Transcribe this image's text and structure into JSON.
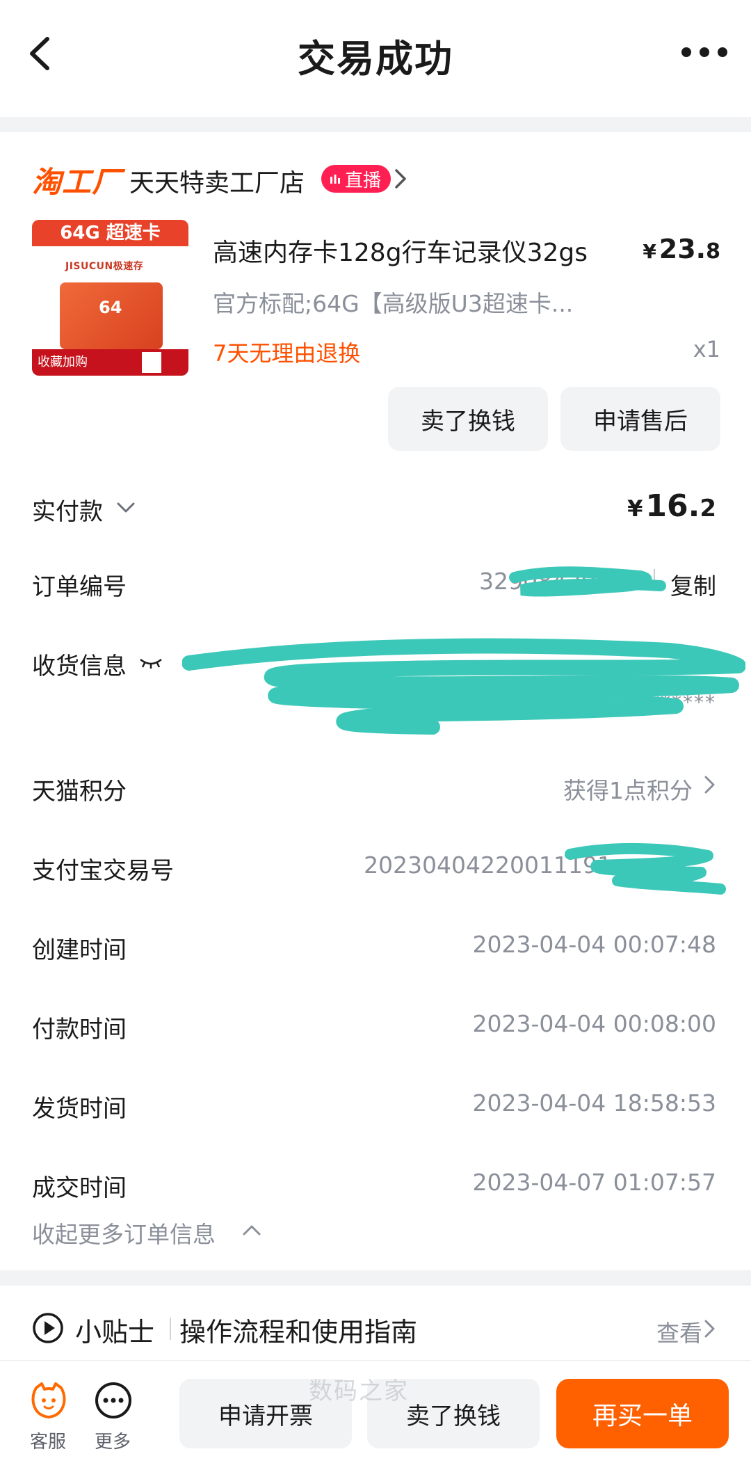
{
  "header": {
    "title": "交易成功"
  },
  "shop": {
    "brand": "淘工厂",
    "name": "天天特卖工厂店",
    "live_badge": "直播"
  },
  "product": {
    "image": {
      "top_text": "64G 超速卡",
      "logo_text": "JISUCUN极速存",
      "card_text": "64",
      "bottom_text": "收藏加购"
    },
    "title": "高速内存卡128g行车记录仪32gs",
    "price_yen": "¥",
    "price_int": "23.",
    "price_dec": "8",
    "spec": "官方标配;64G【高级版U3超速卡...",
    "return_policy": "7天无理由退换",
    "quantity": "x1",
    "buttons": {
      "sell": "卖了换钱",
      "after_sale": "申请售后"
    }
  },
  "info": {
    "paid_label": "实付款",
    "paid_yen": "¥",
    "paid_int": "16.",
    "paid_dec": "2",
    "order_no_label": "订单编号",
    "order_no_value": "32908429460",
    "copy_label": "复制",
    "shipping_label": "收货信息",
    "shipping_value_masked": "**************",
    "points_label": "天猫积分",
    "points_value": "获得1点积分",
    "alipay_label": "支付宝交易号",
    "alipay_value": "20230404220011191",
    "created_label": "创建时间",
    "created_value": "2023-04-04 00:07:48",
    "paytime_label": "付款时间",
    "paytime_value": "2023-04-04 00:08:00",
    "shiptime_label": "发货时间",
    "shiptime_value": "2023-04-04 18:58:53",
    "closetime_label": "成交时间",
    "closetime_value": "2023-04-07 01:07:57",
    "collapse_label": "收起更多订单信息"
  },
  "tips": {
    "title": "小贴士",
    "desc": "操作流程和使用指南",
    "view": "查看"
  },
  "bottom": {
    "cs_label": "客服",
    "more_label": "更多",
    "invoice": "申请开票",
    "sell": "卖了换钱",
    "rebuy": "再买一单",
    "watermark": "数码之家"
  },
  "colors": {
    "accent": "#ff5000",
    "rebuy_bg": "#ff6000",
    "live_badge": "#ff1f52",
    "redaction": "#3cc8b8",
    "muted_text": "#8a8f99"
  }
}
